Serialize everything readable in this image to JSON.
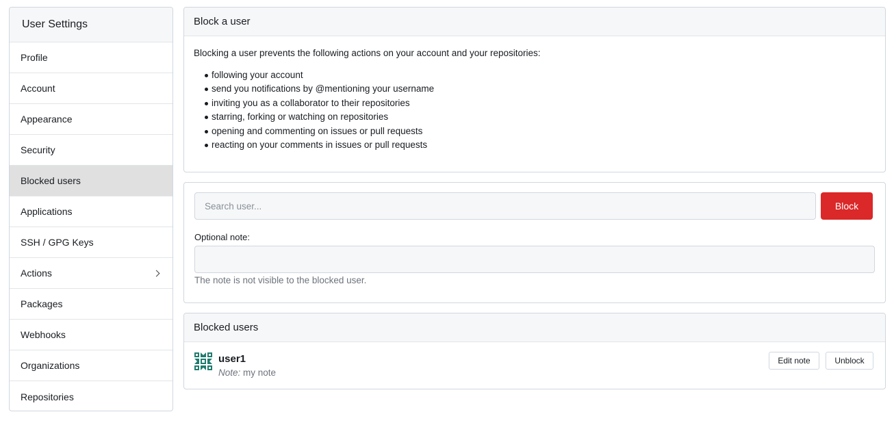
{
  "sidebar": {
    "title": "User Settings",
    "items": [
      {
        "label": "Profile"
      },
      {
        "label": "Account"
      },
      {
        "label": "Appearance"
      },
      {
        "label": "Security"
      },
      {
        "label": "Blocked users",
        "active": true
      },
      {
        "label": "Applications"
      },
      {
        "label": "SSH / GPG Keys"
      },
      {
        "label": "Actions",
        "icon": "chevron-right-icon"
      },
      {
        "label": "Packages"
      },
      {
        "label": "Webhooks"
      },
      {
        "label": "Organizations"
      },
      {
        "label": "Repositories"
      }
    ]
  },
  "block_info": {
    "header": "Block a user",
    "intro": "Blocking a user prevents the following actions on your account and your repositories:",
    "actions": [
      "following your account",
      "send you notifications by @mentioning your username",
      "inviting you as a collaborator to their repositories",
      "starring, forking or watching on repositories",
      "opening and commenting on issues or pull requests",
      "reacting on your comments in issues or pull requests"
    ]
  },
  "block_form": {
    "search_placeholder": "Search user...",
    "block_label": "Block",
    "note_label": "Optional note:",
    "note_help": "The note is not visible to the blocked user."
  },
  "blocked_users": {
    "header": "Blocked users",
    "users": [
      {
        "name": "user1",
        "note_prefix": "Note:",
        "note": "my note",
        "avatar_icon": "identicon-avatar-icon"
      }
    ],
    "edit_note_label": "Edit note",
    "unblock_label": "Unblock"
  },
  "colors": {
    "danger": "#db2828",
    "avatar": "#1e7b6c",
    "active_item": "#e0e0e0"
  }
}
